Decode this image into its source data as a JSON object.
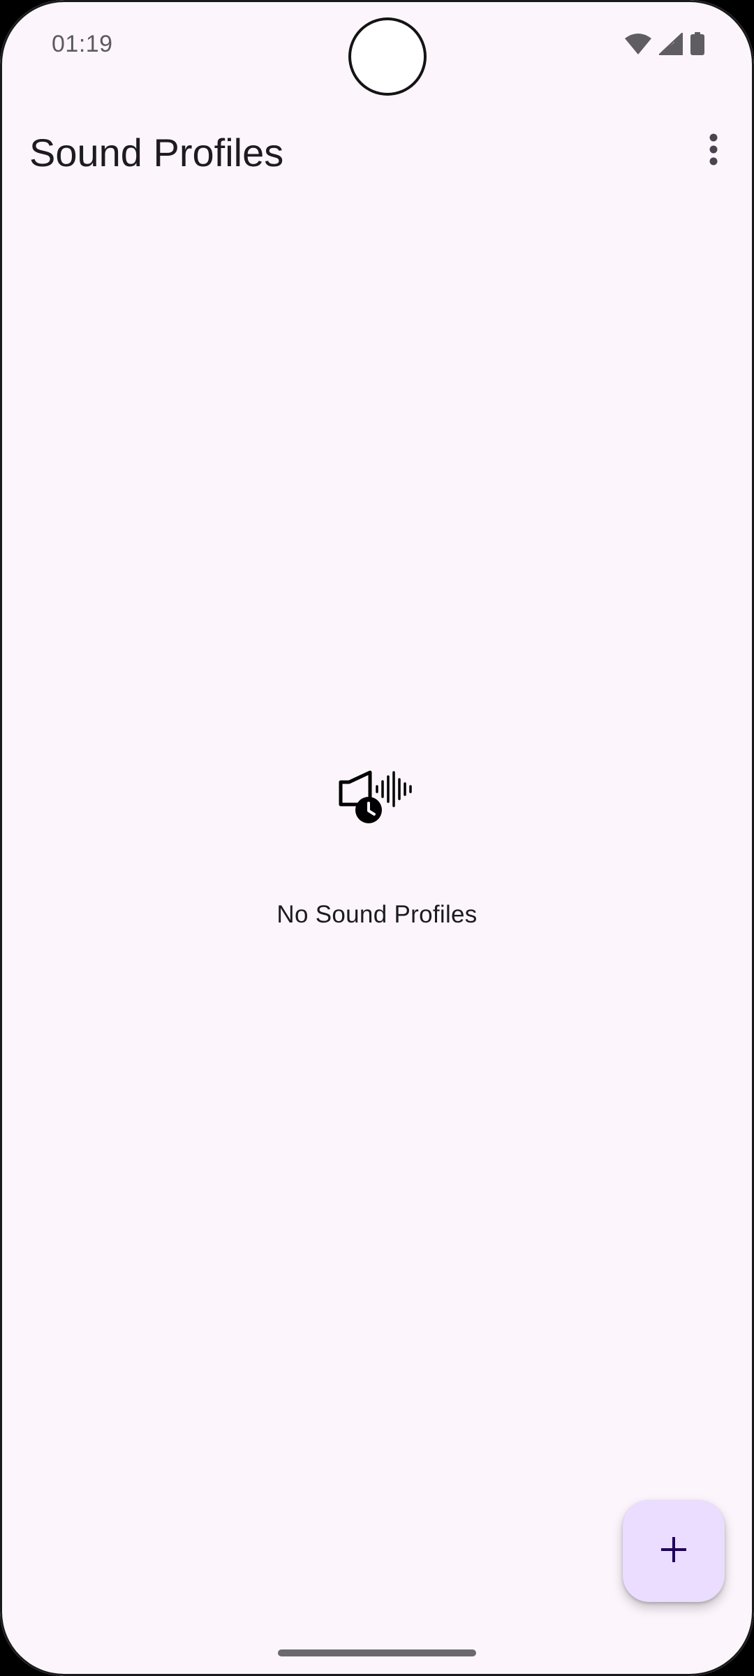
{
  "status_bar": {
    "time": "01:19",
    "icons": [
      "wifi-icon",
      "cellular-signal-icon",
      "battery-icon"
    ]
  },
  "app_bar": {
    "title": "Sound Profiles",
    "menu_icon": "more-vert-icon"
  },
  "empty_state": {
    "icon": "speaker-clock-waveform-icon",
    "message": "No Sound Profiles"
  },
  "fab": {
    "icon": "plus-icon"
  },
  "colors": {
    "background": "#fcf6fc",
    "fab_background": "#eaddff",
    "fab_icon": "#21005d",
    "text_primary": "#1d1b20"
  }
}
